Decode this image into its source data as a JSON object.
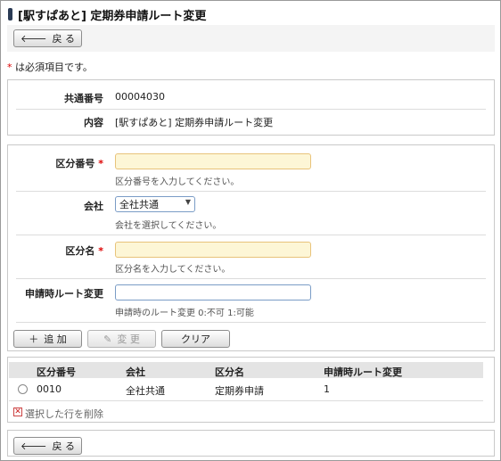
{
  "header": {
    "title": "[駅すぱあと] 定期券申請ルート変更"
  },
  "nav": {
    "back_label": "戻 る",
    "back_icon": "arrow-left-icon"
  },
  "required_note": {
    "mark": "*",
    "text": " は必須項目です。"
  },
  "info": {
    "common_no_label": "共通番号",
    "common_no_value": "00004030",
    "content_label": "内容",
    "content_value": "[駅すぱあと] 定期券申請ルート変更"
  },
  "form": {
    "division_no": {
      "label": "区分番号",
      "required_mark": "*",
      "value": "",
      "hint": "区分番号を入力してください。"
    },
    "company": {
      "label": "会社",
      "selected": "全社共通",
      "hint": "会社を選択してください。"
    },
    "division_name": {
      "label": "区分名",
      "required_mark": "*",
      "value": "",
      "hint": "区分名を入力してください。"
    },
    "route_change": {
      "label": "申請時ルート変更",
      "value": "",
      "hint": "申請時のルート変更 0:不可 1:可能"
    }
  },
  "actions": {
    "add_label": "追 加",
    "change_label": "変 更",
    "clear_label": "クリア"
  },
  "table": {
    "columns": [
      "区分番号",
      "会社",
      "区分名",
      "申請時ルート変更"
    ],
    "rows": [
      {
        "division_no": "0010",
        "company": "全社共通",
        "division_name": "定期券申請",
        "route_change": "1"
      }
    ]
  },
  "delete": {
    "label": "選択した行を削除"
  },
  "colors": {
    "required": "#dd0000",
    "input_required_bg": "#fdf6d6",
    "title_mark": "#2b3b55"
  }
}
